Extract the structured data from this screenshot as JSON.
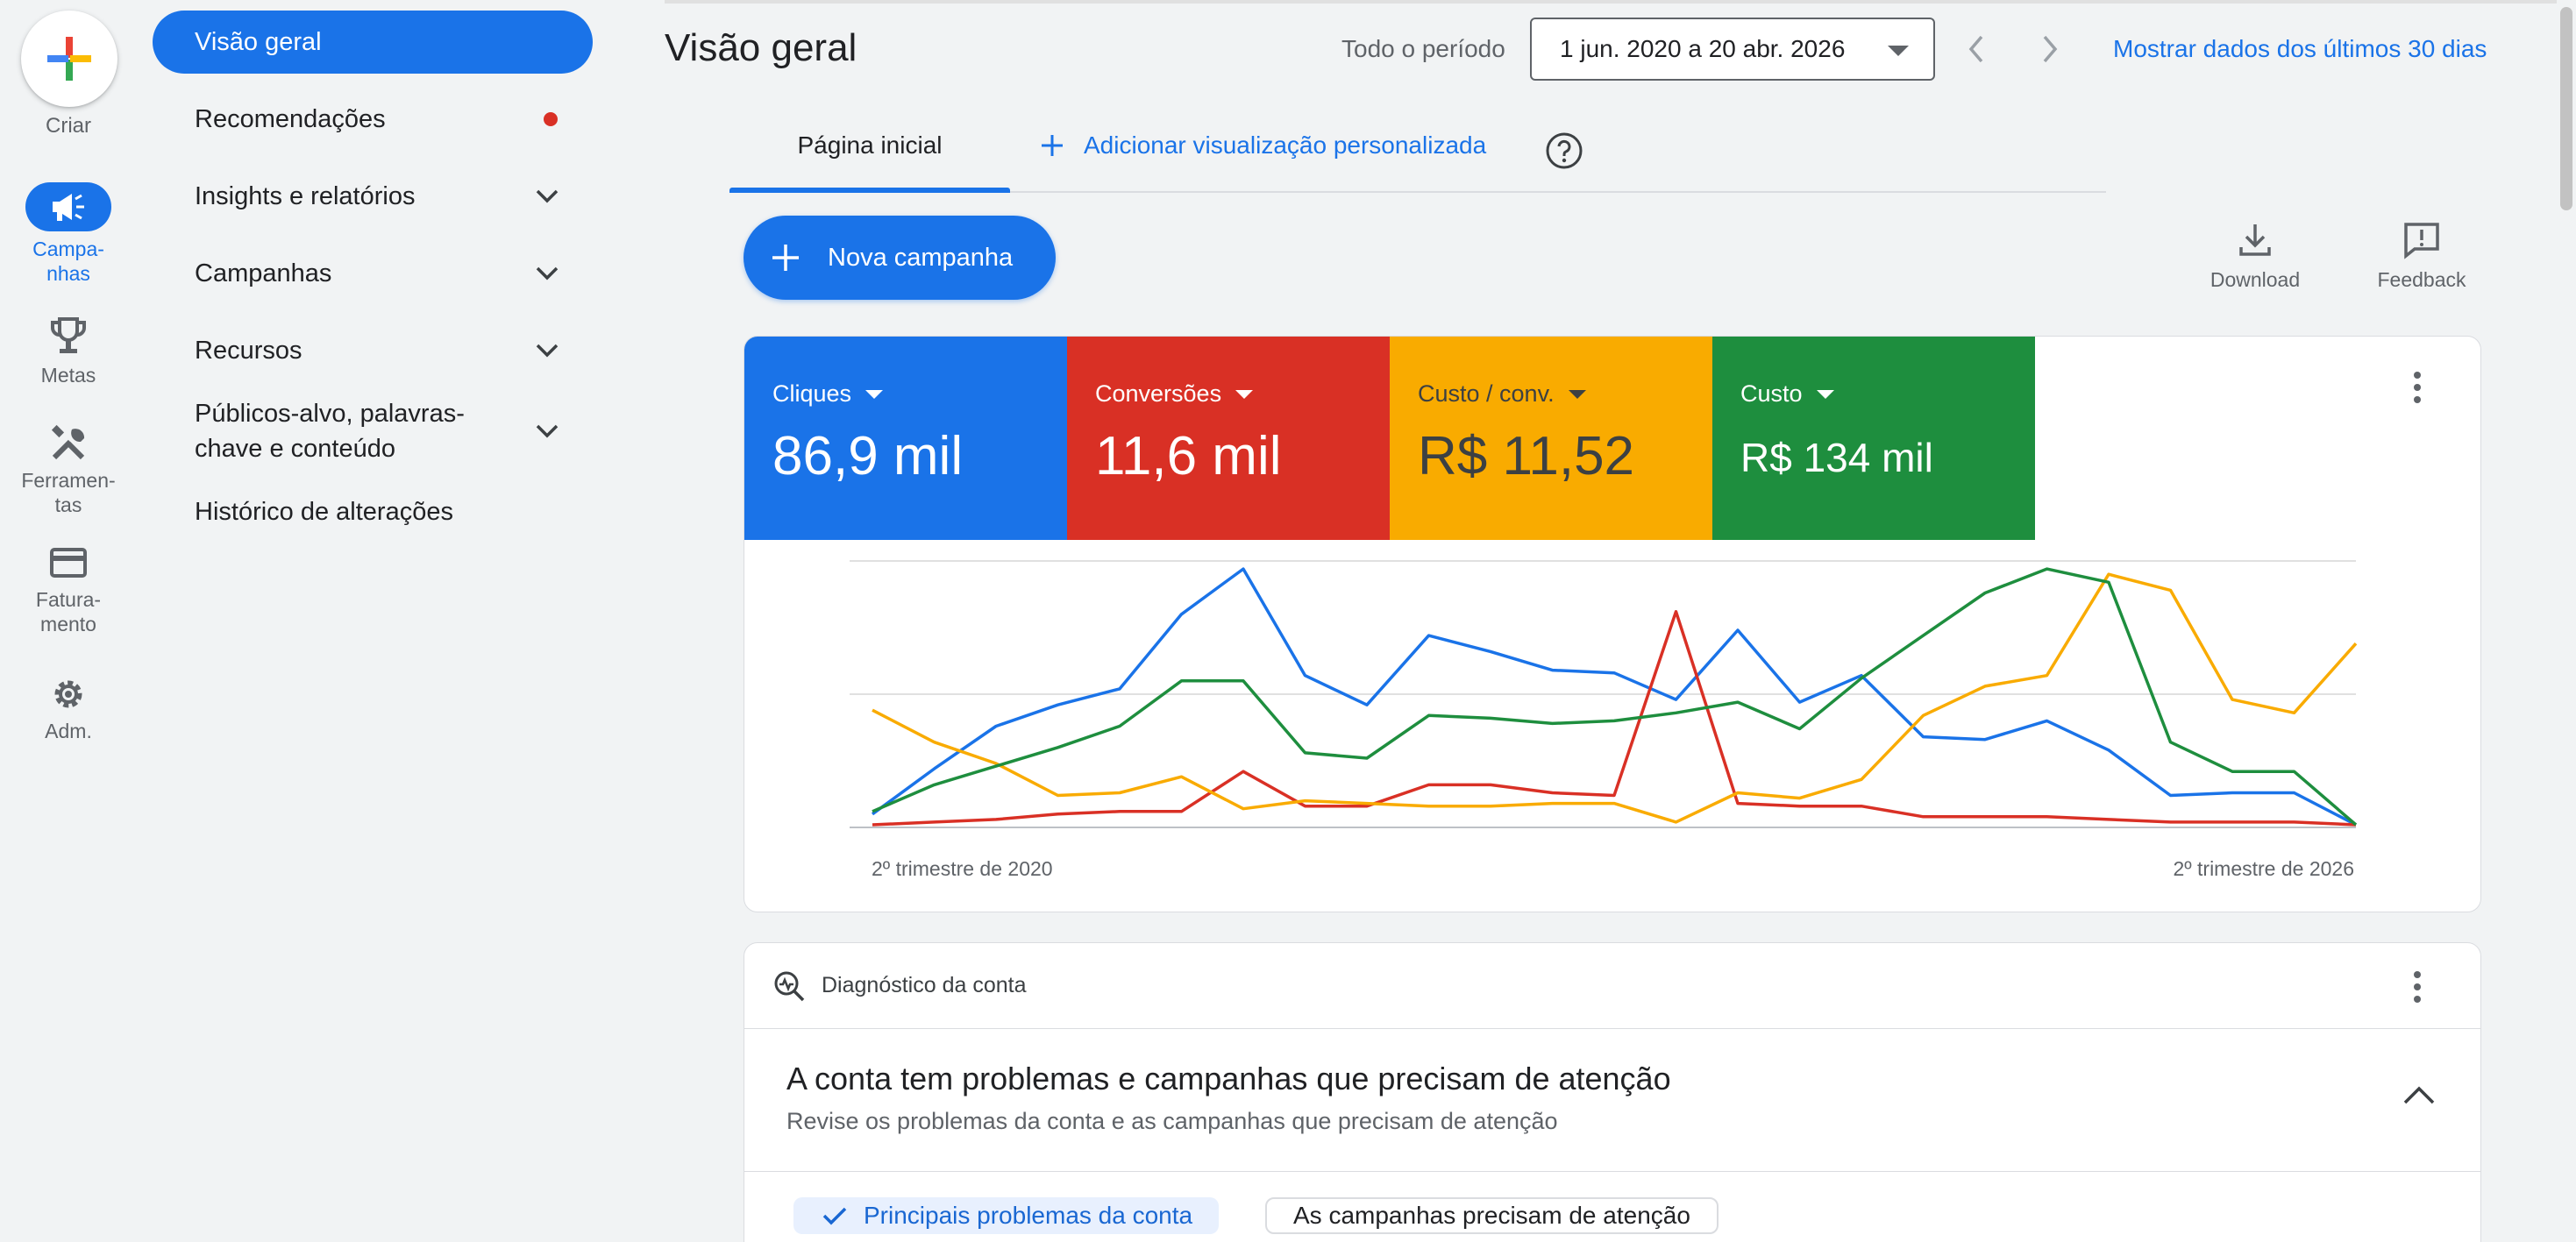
{
  "rail": {
    "create_label": "Criar",
    "items": [
      {
        "label_l1": "Campa-",
        "label_l2": "nhas",
        "icon": "campaigns-icon"
      },
      {
        "label_l1": "Metas",
        "icon": "trophy-icon"
      },
      {
        "label_l1": "Ferramen-",
        "label_l2": "tas",
        "icon": "tools-icon"
      },
      {
        "label_l1": "Fatura-",
        "label_l2": "mento",
        "icon": "billing-icon"
      },
      {
        "label_l1": "Adm.",
        "icon": "gear-icon"
      }
    ]
  },
  "nav": {
    "overview": "Visão geral",
    "recommendations": "Recomendações",
    "insights": "Insights e relatórios",
    "campaigns": "Campanhas",
    "assets": "Recursos",
    "audiences_l1": "Públicos-alvo, palavras-",
    "audiences_l2": "chave e conteúdo",
    "history": "Histórico de alterações"
  },
  "header": {
    "title": "Visão geral",
    "period_label": "Todo o período",
    "date_range": "1 jun. 2020 a 20 abr. 2026",
    "last30": "Mostrar dados dos últimos 30 dias"
  },
  "tabs": {
    "home": "Página inicial",
    "add_view": "Adicionar visualização personalizada"
  },
  "actions": {
    "new_campaign": "Nova campanha",
    "download": "Download",
    "feedback": "Feedback"
  },
  "metrics": [
    {
      "label": "Cliques",
      "value": "86,9 mil",
      "color": "#1a73e8"
    },
    {
      "label": "Conversões",
      "value": "11,6 mil",
      "color": "#d93025"
    },
    {
      "label": "Custo / conv.",
      "value": "R$ 11,52",
      "color": "#f9ab00"
    },
    {
      "label": "Custo",
      "value": "R$ 134 mil",
      "color": "#1e8e3e"
    }
  ],
  "chart_data": {
    "type": "line",
    "x_start_label": "2º trimestre de 2020",
    "x_end_label": "2º trimestre de 2026",
    "ylim": [
      0,
      100
    ],
    "grid": true,
    "series": [
      {
        "color": "#1a73e8",
        "values": [
          5,
          22,
          38,
          46,
          52,
          80,
          97,
          57,
          46,
          72,
          66,
          59,
          58,
          48,
          74,
          47,
          57,
          34,
          33,
          40,
          29,
          12,
          13,
          13,
          1
        ]
      },
      {
        "color": "#d93025",
        "values": [
          1,
          2,
          3,
          5,
          6,
          6,
          21,
          8,
          8,
          16,
          16,
          13,
          12,
          81,
          9,
          8,
          8,
          4,
          4,
          4,
          3,
          2,
          2,
          2,
          1
        ]
      },
      {
        "color": "#f9ab00",
        "values": [
          44,
          32,
          24,
          12,
          13,
          19,
          7,
          10,
          9,
          8,
          8,
          9,
          9,
          2,
          13,
          11,
          18,
          42,
          53,
          57,
          95,
          89,
          48,
          43,
          69
        ]
      },
      {
        "color": "#1e8e3e",
        "values": [
          6,
          16,
          23,
          30,
          38,
          55,
          55,
          28,
          26,
          42,
          41,
          39,
          40,
          43,
          47,
          37,
          56,
          72,
          88,
          97,
          92,
          32,
          21,
          21,
          1
        ]
      }
    ]
  },
  "diagnostics": {
    "title": "Diagnóstico da conta",
    "heading": "A conta tem problemas e campanhas que precisam de atenção",
    "subtitle": "Revise os problemas da conta e as campanhas que precisam de atenção",
    "chip_selected": "Principais problemas da conta",
    "chip_other": "As campanhas precisam de atenção"
  }
}
